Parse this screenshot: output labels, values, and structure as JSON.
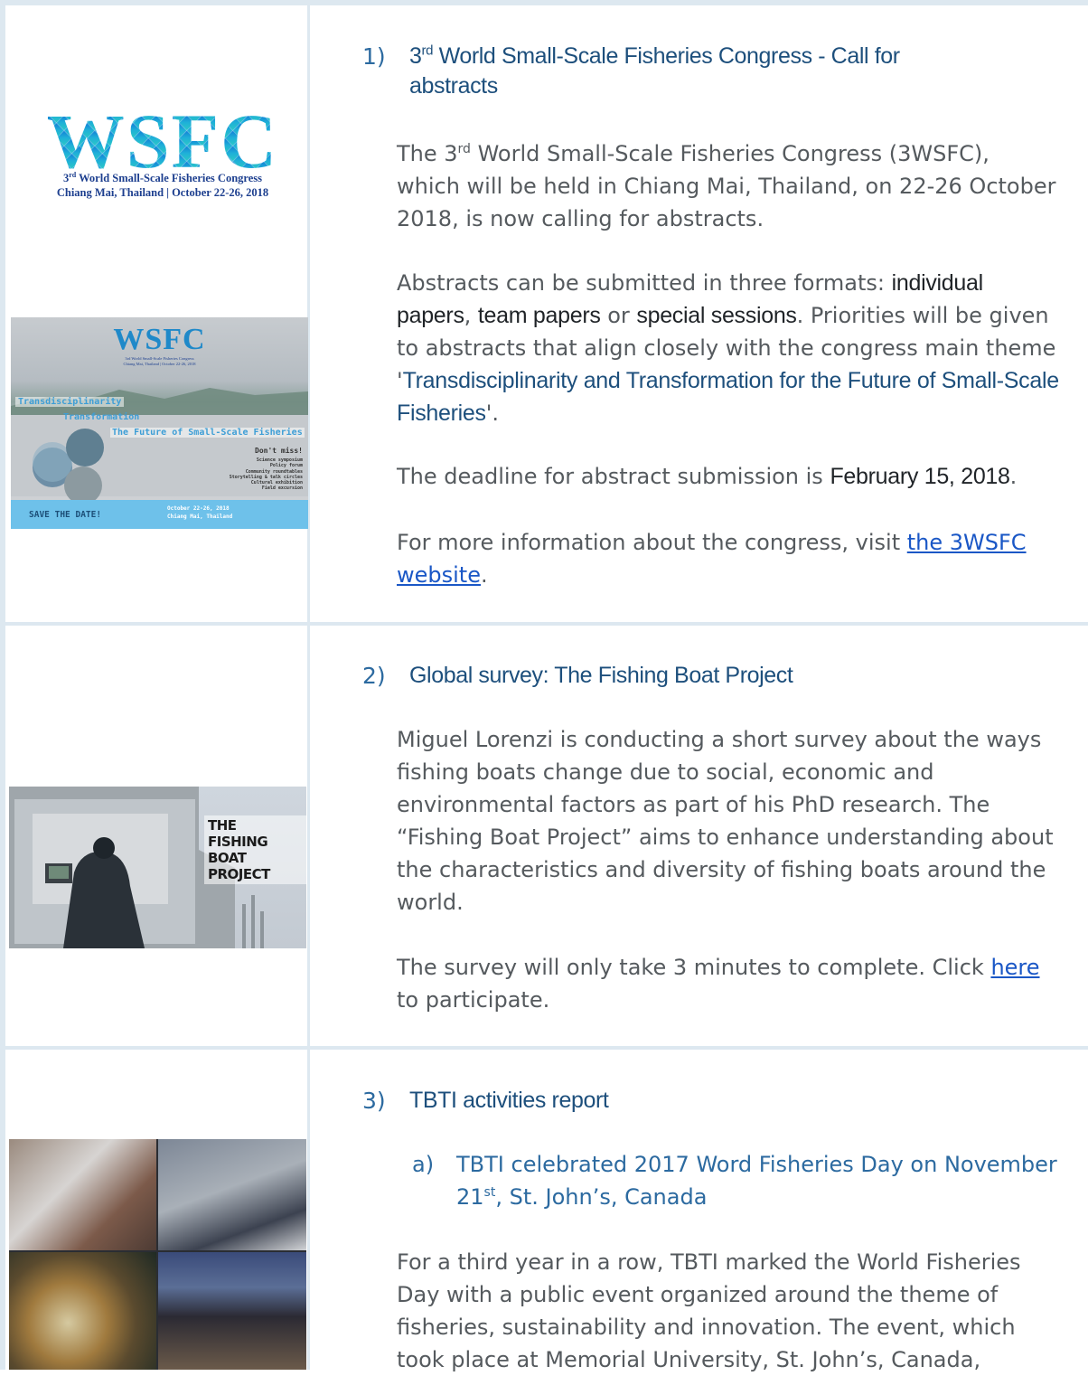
{
  "items": [
    {
      "number": "1)",
      "title_sup": "rd",
      "title_rest": " World Small-Scale Fisheries Congress - Call for abstracts",
      "title_line1": "World Small-Scale Fisheries Congress - Call for",
      "title_line2": "abstracts",
      "title_num": "3",
      "p1a": "The 3",
      "p1sup": "rd",
      "p1b": " World Small-Scale Fisheries Congress (3WSFC), which will be held in Chiang Mai, Thailand, on 22-26 October 2018, is now calling for abstracts.",
      "p2a": "Abstracts can be submitted in three formats: ",
      "p2b1": "individual papers",
      "p2c": ", ",
      "p2b2": "team papers",
      "p2d": " or ",
      "p2b3": "special sessions",
      "p2e": ". Priorities will be given to abstracts that align closely with the congress main theme '",
      "p2theme": "Transdisciplinarity and Transformation for the Future of Small-Scale Fisheries",
      "p2f": "'.",
      "p3a": "The deadline for abstract submission is ",
      "p3b": "February 15, 2018",
      "p3c": ".",
      "p4a": "For more information about the congress, visit ",
      "p4link": "the 3WSFC website",
      "p4c": "."
    },
    {
      "number": "2)",
      "title": "Global survey: The Fishing Boat Project",
      "p1": "Miguel Lorenzi is conducting a short survey about the ways fishing boats change due to social, economic and environmental factors as part of his PhD research. The “Fishing Boat Project” aims to enhance understanding about the characteristics and diversity of fishing boats around the world.",
      "p2a": "The survey will only take 3 minutes to complete. Click ",
      "p2link": "here",
      "p2c": " to participate."
    },
    {
      "number": "3)",
      "title": "TBTI activities report",
      "sub_letter": "a)",
      "sub_a": "TBTI celebrated 2017 Word Fisheries Day on November 21",
      "sub_sup": "st",
      "sub_b": ", St. John’s, Canada",
      "p1": "For a third year in a row, TBTI marked the World Fisheries Day with a public event organized around the theme of fisheries, sustainability and innovation. The event, which took place at Memorial University, St. John’s, Canada,"
    }
  ],
  "logo": {
    "text": "WSFC",
    "line1_num": "3",
    "line1_sup": "rd",
    "line1_rest": " World Small-Scale Fisheries Congress",
    "line2": "Chiang Mai, Thailand | October 22-26, 2018"
  },
  "poster": {
    "logo": "WSFC",
    "tag1": "3rd World Small-Scale Fisheries Congress",
    "tag2": "Chiang Mai, Thailand | October 22-26, 2018",
    "t1": "Transdisciplinarity",
    "t2": "Transformation",
    "t3": "The Future of Small-Scale Fisheries",
    "dont": "Don't miss!",
    "list": [
      "Science symposium",
      "Policy forum",
      "Community roundtables",
      "Storytelling & talk circles",
      "Cultural exhibition",
      "Field excursion"
    ],
    "save": "SAVE THE DATE!",
    "date1": "October 22-26, 2018",
    "date2": "Chiang Mai, Thailand"
  },
  "boat_image": {
    "line1": "THE",
    "line2": "FISHING BOAT",
    "line3": "PROJECT"
  },
  "colors": {
    "heading": "#1d4f7c",
    "link": "#1a57c6",
    "divider": "#dde8f0"
  }
}
